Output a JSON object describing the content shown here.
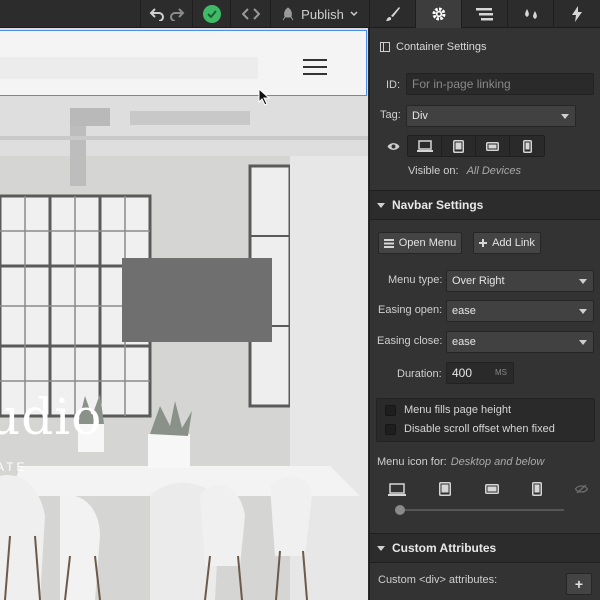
{
  "toolbar": {
    "publish_label": "Publish",
    "icons": [
      "undo-icon",
      "redo-icon",
      "check-icon",
      "code-toggle-icon",
      "publish-icon",
      "brush-icon",
      "gear-icon",
      "navigator-icon",
      "drops-icon",
      "lightning-icon"
    ],
    "active_tab": "gear",
    "accent_green": "#3fba67"
  },
  "hero": {
    "title": "udio",
    "subtitle": "ATE"
  },
  "container_settings": {
    "title": "Container Settings",
    "id_label": "ID:",
    "id_placeholder": "For in-page linking",
    "tag_label": "Tag:",
    "tag_value": "Div",
    "visible_on_label": "Visible on:",
    "visible_on_value": "All Devices"
  },
  "navbar_settings": {
    "title": "Navbar Settings",
    "open_menu_label": "Open Menu",
    "add_link_label": "Add Link",
    "menu_type_label": "Menu type:",
    "menu_type_value": "Over Right",
    "easing_open_label": "Easing open:",
    "easing_open_value": "ease",
    "easing_close_label": "Easing close:",
    "easing_close_value": "ease",
    "duration_label": "Duration:",
    "duration_value": "400",
    "duration_unit": "MS",
    "fills_height_label": "Menu fills page height",
    "disable_scroll_label": "Disable scroll offset when fixed",
    "menu_icon_label": "Menu icon for:",
    "menu_icon_value": "Desktop and below"
  },
  "custom_attributes": {
    "title": "Custom Attributes",
    "subtitle": "Custom <div> attributes:",
    "add_label": "+"
  }
}
